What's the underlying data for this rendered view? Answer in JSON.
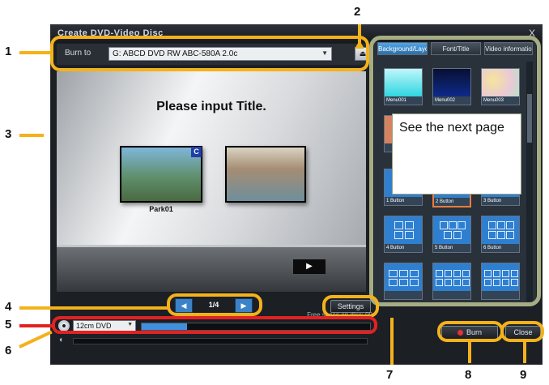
{
  "window": {
    "title": "Create DVD-Video Disc",
    "minimize_glyph": "_",
    "close_glyph": "X"
  },
  "burn_bar": {
    "label": "Burn to",
    "drive": "G: ABCD DVD RW ABC-580A 2.0c",
    "eject_glyph": "⏏"
  },
  "preview": {
    "title": "Please input Title.",
    "thumbnails": [
      {
        "caption": "Park01",
        "badge": "C"
      },
      {
        "caption": "",
        "badge": ""
      }
    ],
    "play_glyph": "▶"
  },
  "pager": {
    "prev_glyph": "◀",
    "text": "1/4",
    "next_glyph": "▶"
  },
  "settings_label": "Settings",
  "disc": {
    "type": "12cm DVD",
    "used_fraction": 0.2,
    "free_space_text": "Free space on disc: 00"
  },
  "panel": {
    "tabs": [
      "Background/Layout",
      "Font/Title",
      "Video information"
    ],
    "active_tab": 0,
    "backgrounds": [
      {
        "label": "Menu001",
        "color": "#2fd6e0"
      },
      {
        "label": "Menu002",
        "color": "#0d2a8a"
      },
      {
        "label": "Menu003",
        "color": "#e9c9d6"
      }
    ],
    "layouts": [
      {
        "label": "1 Button"
      },
      {
        "label": "2 Button"
      },
      {
        "label": "3 Button"
      },
      {
        "label": "4 Button"
      },
      {
        "label": "5 Button"
      },
      {
        "label": "6 Button"
      },
      {
        "label": ""
      },
      {
        "label": ""
      },
      {
        "label": ""
      }
    ],
    "selected_layout": 1
  },
  "note": "See the next page",
  "buttons": {
    "burn": "Burn",
    "close": "Close"
  },
  "callouts": [
    "1",
    "2",
    "3",
    "4",
    "5",
    "6",
    "7",
    "8",
    "9"
  ],
  "colors": {
    "highlight": "#f3b21b",
    "highlight_red": "#e22222",
    "panel_highlight": "#a6ad84",
    "accent_blue": "#3f8fdf"
  }
}
